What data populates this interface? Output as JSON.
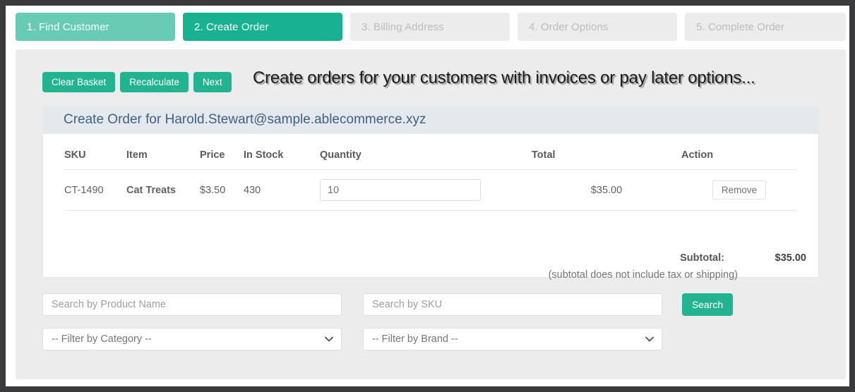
{
  "steps": [
    {
      "label": "1. Find Customer",
      "state": "done"
    },
    {
      "label": "2. Create Order",
      "state": "active"
    },
    {
      "label": "3. Billing Address",
      "state": "upcoming"
    },
    {
      "label": "4. Order Options",
      "state": "upcoming"
    },
    {
      "label": "5. Complete Order",
      "state": "upcoming"
    }
  ],
  "toolbar": {
    "clear_basket_label": "Clear Basket",
    "recalculate_label": "Recalculate",
    "next_label": "Next",
    "tagline": "Create orders for your customers with invoices or pay later options..."
  },
  "order": {
    "header": "Create Order for Harold.Stewart@sample.ablecommerce.xyz",
    "columns": [
      "SKU",
      "Item",
      "Price",
      "In Stock",
      "Quantity",
      "Total",
      "Action"
    ],
    "rows": [
      {
        "sku": "CT-1490",
        "item": "Cat Treats",
        "price": "$3.50",
        "in_stock": "430",
        "quantity": "10",
        "quantity_placeholder": "10",
        "total": "$35.00",
        "action_label": "Remove"
      }
    ],
    "subtotal_label": "Subtotal:",
    "subtotal_value": "$35.00",
    "subtotal_note": "(subtotal does not include tax or shipping)"
  },
  "search": {
    "product_name_placeholder": "Search by Product Name",
    "product_name_value": "",
    "sku_placeholder": "Search by SKU",
    "sku_value": "",
    "search_button_label": "Search",
    "category_selected": "-- Filter by Category --",
    "brand_selected": "-- Filter by Brand --"
  },
  "colors": {
    "accent_green": "#22b391",
    "step_done_green": "#68cbb4",
    "step_active_green": "#18b293",
    "step_upcoming_gray": "#ececec",
    "panel_gray": "#ececec",
    "order_header_blue": "#e3e9ed",
    "order_header_text": "#3f6184",
    "window_frame": "#3a3a3c"
  }
}
